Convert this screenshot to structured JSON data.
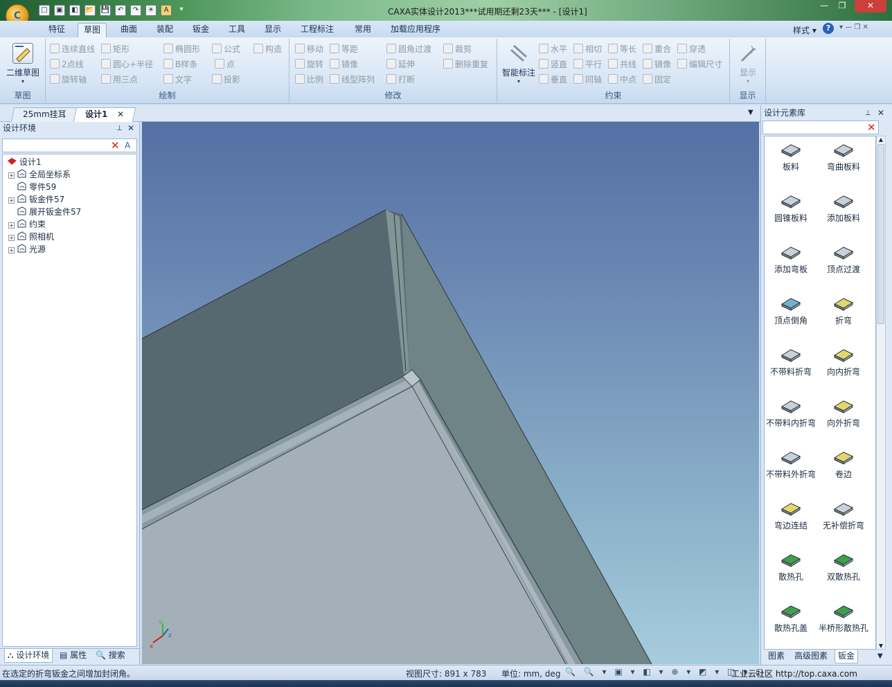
{
  "window": {
    "title": "CAXA实体设计2013***试用期还剩23天*** - [设计1]",
    "min_symbol": "—",
    "max_symbol": "❐",
    "close_symbol": "✕"
  },
  "quick_access": {
    "icons": [
      "new-file-icon",
      "open-drawing-icon",
      "print-preview-icon",
      "open-folder-icon",
      "save-icon",
      "undo-icon",
      "redo-icon",
      "light-icon",
      "design-tree-icon",
      "dropdown-icon"
    ],
    "glyphs": [
      "□",
      "▣",
      "◧",
      "📂",
      "💾",
      "↶",
      "↷",
      "☀",
      "A",
      "▾"
    ]
  },
  "ribbon_tabs": [
    "特征",
    "草图",
    "曲面",
    "装配",
    "钣金",
    "工具",
    "显示",
    "工程标注",
    "常用",
    "加载应用程序"
  ],
  "active_ribbon_tab": "草图",
  "ribbon_right": {
    "style_label": "样式",
    "help_symbol": "?"
  },
  "ribbon": {
    "sketch_group": {
      "big_button": "二维草图",
      "label": "草图"
    },
    "draw_group": {
      "label": "绘制",
      "row1": [
        "连续直线",
        "矩形",
        "椭圆形",
        "公式",
        "构造"
      ],
      "row2": [
        "2点线",
        "圆心+半径",
        "B样条",
        "点"
      ],
      "row3": [
        "旋转轴",
        "用三点",
        "文字",
        "投影"
      ]
    },
    "modify_group": {
      "label": "修改",
      "row1": [
        "移动",
        "等距",
        "圆角过渡",
        "裁剪"
      ],
      "row2": [
        "旋转",
        "镜像",
        "延伸",
        "删除重复"
      ],
      "row3": [
        "比例",
        "线型阵列",
        "打断"
      ]
    },
    "constraint_group": {
      "label": "约束",
      "big_button": "智能标注",
      "row1": [
        "水平",
        "相切",
        "等长",
        "重合",
        "穿透"
      ],
      "row2": [
        "竖直",
        "平行",
        "共线",
        "镜像",
        "编辑尺寸"
      ],
      "row3": [
        "垂直",
        "同轴",
        "中点",
        "固定"
      ]
    },
    "display_group": {
      "big_button": "显示",
      "label": "显示"
    }
  },
  "doc_tabs": [
    "25mm挂耳",
    "设计1"
  ],
  "active_doc_tab": "设计1",
  "left_panel": {
    "title": "设计环境",
    "tree": [
      {
        "label": "设计1",
        "expandable": false,
        "icon": "design-root-icon"
      },
      {
        "label": "全局坐标系",
        "expandable": true,
        "icon": "coordinate-system-icon"
      },
      {
        "label": "零件59",
        "expandable": false,
        "icon": "part-icon"
      },
      {
        "label": "钣金件57",
        "expandable": true,
        "icon": "sheet-metal-icon"
      },
      {
        "label": "展开钣金件57",
        "expandable": false,
        "icon": "unfolded-sheet-metal-icon"
      },
      {
        "label": "约束",
        "expandable": true,
        "icon": "constraint-icon"
      },
      {
        "label": "照相机",
        "expandable": true,
        "icon": "camera-icon"
      },
      {
        "label": "光源",
        "expandable": true,
        "icon": "light-source-icon"
      }
    ],
    "bottom_tabs": [
      "设计环境",
      "属性",
      "搜索"
    ]
  },
  "right_panel": {
    "title": "设计元素库",
    "items": [
      {
        "label": "板料",
        "icon": "sheet-stock-icon",
        "color": "#c9d2da"
      },
      {
        "label": "弯曲板料",
        "icon": "bent-sheet-icon",
        "color": "#c9d2da"
      },
      {
        "label": "圆锥板料",
        "icon": "cone-sheet-icon",
        "color": "#c9d2da"
      },
      {
        "label": "添加板料",
        "icon": "add-sheet-icon",
        "color": "#c9d2da"
      },
      {
        "label": "添加弯板",
        "icon": "add-bend-plate-icon",
        "color": "#c9d2da"
      },
      {
        "label": "顶点过渡",
        "icon": "vertex-transition-icon",
        "color": "#c9d2da"
      },
      {
        "label": "顶点倒角",
        "icon": "vertex-chamfer-icon",
        "color": "#6fb2d6"
      },
      {
        "label": "折弯",
        "icon": "bend-icon",
        "color": "#e2d86a"
      },
      {
        "label": "不带料折弯",
        "icon": "bend-without-material-icon",
        "color": "#c9d2da"
      },
      {
        "label": "向内折弯",
        "icon": "inward-bend-icon",
        "color": "#e2d86a"
      },
      {
        "label": "不带料内折弯",
        "icon": "inner-bend-without-material-icon",
        "color": "#c9d2da"
      },
      {
        "label": "向外折弯",
        "icon": "outward-bend-icon",
        "color": "#e2d86a"
      },
      {
        "label": "不带料外折弯",
        "icon": "outer-bend-without-material-icon",
        "color": "#c9d2da"
      },
      {
        "label": "卷边",
        "icon": "hem-icon",
        "color": "#e2d86a"
      },
      {
        "label": "弯边连结",
        "icon": "edge-joint-icon",
        "color": "#e2d86a"
      },
      {
        "label": "无补偿折弯",
        "icon": "uncompensated-bend-icon",
        "color": "#c9d2da"
      },
      {
        "label": "散热孔",
        "icon": "vent-hole-icon",
        "color": "#3ea04a"
      },
      {
        "label": "双散热孔",
        "icon": "double-vent-hole-icon",
        "color": "#3ea04a"
      },
      {
        "label": "散热孔盖",
        "icon": "vent-cover-icon",
        "color": "#3ea04a"
      },
      {
        "label": "半桥形散热孔",
        "icon": "half-bridge-vent-icon",
        "color": "#3ea04a"
      }
    ],
    "bottom_tabs": [
      "图素",
      "高级图素",
      "钣金"
    ]
  },
  "status": {
    "message": "在选定的折弯钣金之间增加封闭角。",
    "view_size": "视图尺寸: 891 x 783",
    "units": "单位: mm, deg",
    "watermark": "工业云社区 http://top.caxa.com"
  },
  "colors": {
    "viewport_top": "#5470a4",
    "viewport_bottom": "#a6ccdd",
    "face_dark": "#566870",
    "face_mid": "#6f8486",
    "face_light": "#a4b0b8",
    "accent_blue": "#2a5fb8"
  },
  "triad": {
    "x": "x",
    "y": "y",
    "z": "z"
  }
}
